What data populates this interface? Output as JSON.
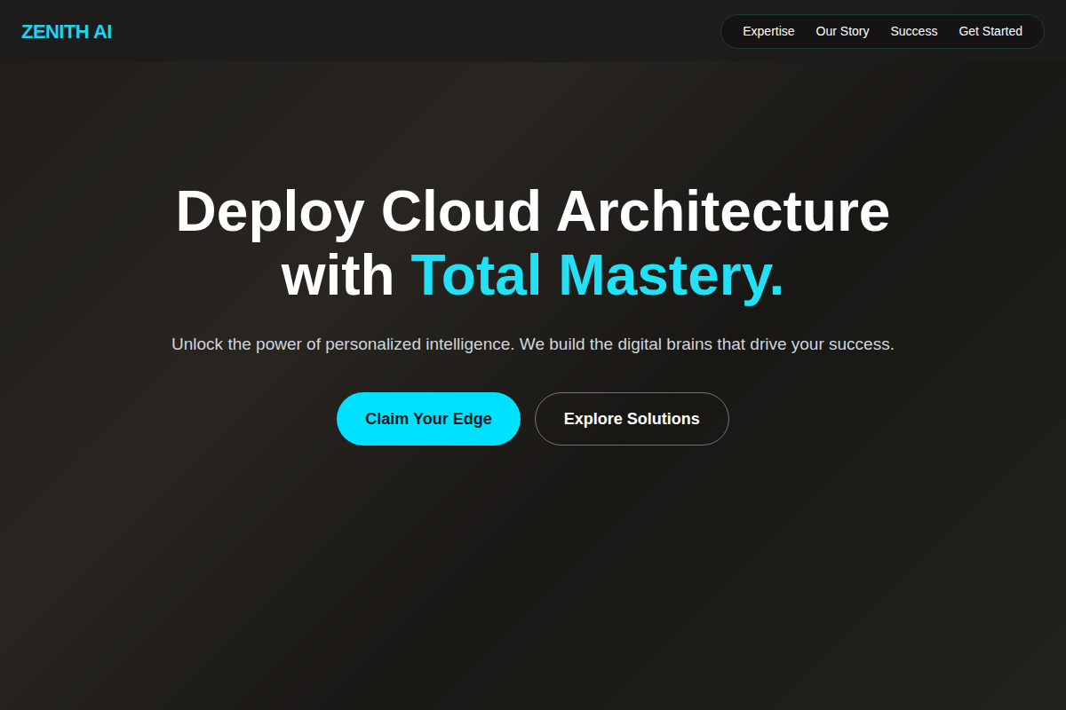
{
  "header": {
    "logo": "ZENITH AI",
    "nav": [
      {
        "label": "Expertise"
      },
      {
        "label": "Our Story"
      },
      {
        "label": "Success"
      },
      {
        "label": "Get Started"
      }
    ]
  },
  "hero": {
    "heading": [
      {
        "text": "Deploy Cloud Architecture with ",
        "highlight": false
      },
      {
        "text": "Total Mastery.",
        "highlight": true
      }
    ],
    "subtitle": "Unlock the power of personalized intelligence. We build the digital brains that drive your success.",
    "buttons": [
      {
        "label": "Claim Your Edge",
        "kind": "primary"
      },
      {
        "label": "Explore Solutions",
        "kind": "outline"
      }
    ]
  }
}
